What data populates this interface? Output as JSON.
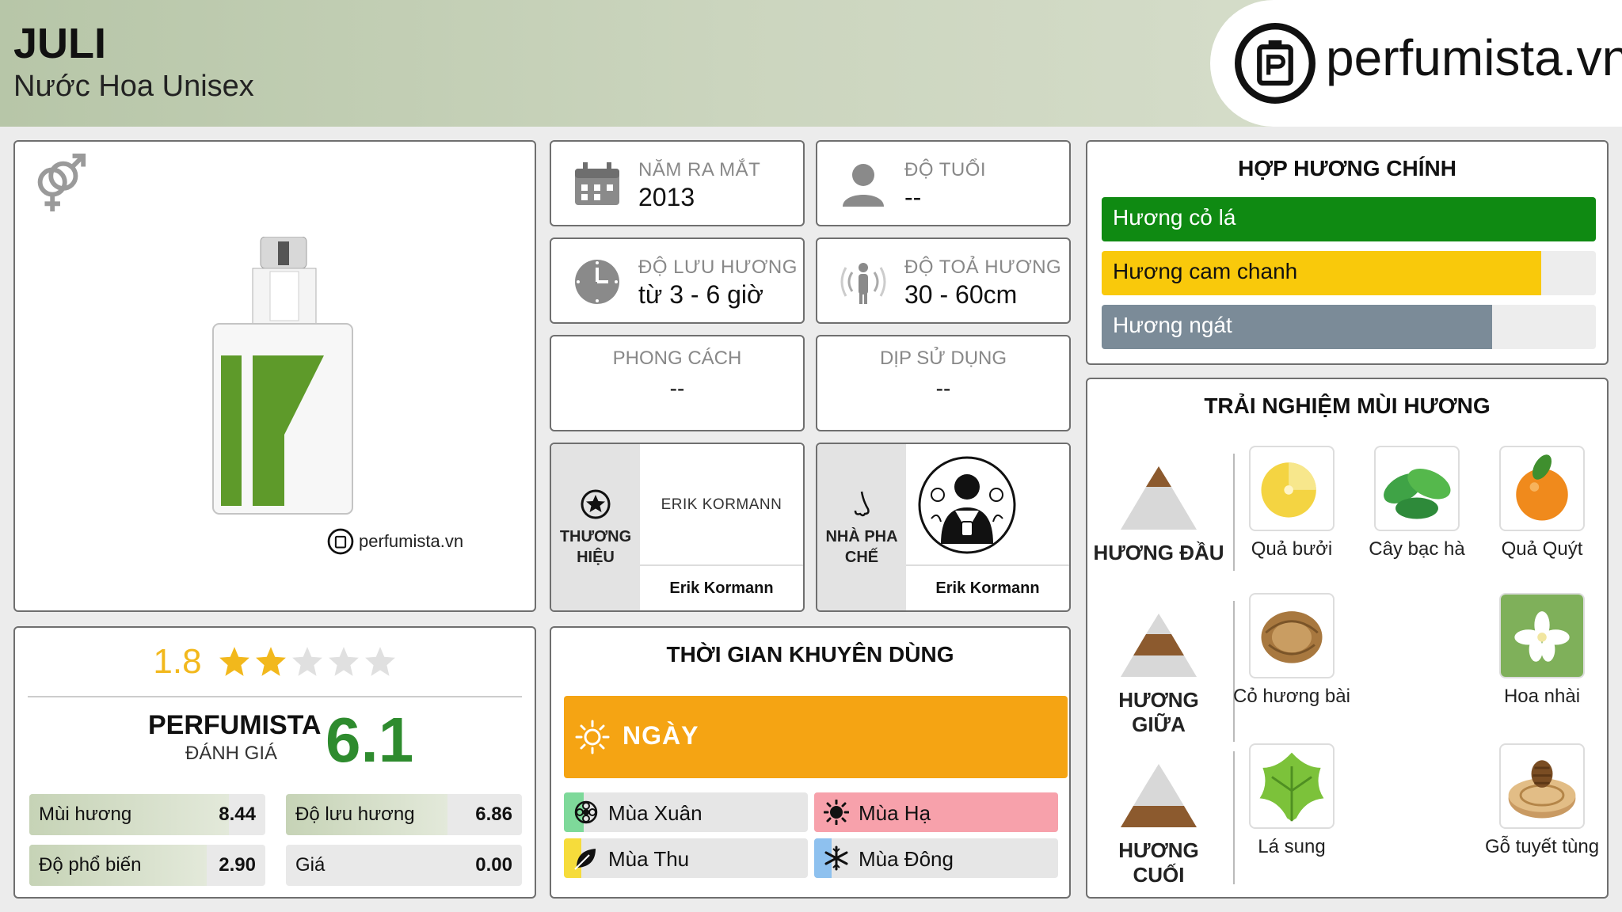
{
  "header": {
    "product_name": "JULI",
    "subtitle": "Nước Hoa Unisex",
    "logo_text": "perfumista.vn"
  },
  "image_card": {
    "gender_icon": "unisex-icon",
    "watermark": "perfumista.vn"
  },
  "info": {
    "year": {
      "label": "NĂM RA MẮT",
      "value": "2013",
      "icon": "calendar-icon"
    },
    "age": {
      "label": "ĐỘ TUỔI",
      "value": "--",
      "icon": "person-icon"
    },
    "longevity": {
      "label": "ĐỘ LƯU HƯƠNG",
      "value": "từ 3 - 6 giờ",
      "icon": "clock-icon"
    },
    "sillage": {
      "label": "ĐỘ TOẢ HƯƠNG",
      "value": "30 - 60cm",
      "icon": "sillage-icon"
    },
    "style": {
      "label": "PHONG CÁCH",
      "value": "--"
    },
    "occasion": {
      "label": "DỊP SỬ DỤNG",
      "value": "--"
    }
  },
  "brand": {
    "label": "THƯƠNG HIỆU",
    "logo_text": "ERIK KORMANN",
    "name": "Erik Kormann",
    "icon": "star-badge-icon"
  },
  "perfumer": {
    "label": "NHÀ PHA CHẾ",
    "name": "Erik Kormann",
    "icon": "nose-icon"
  },
  "accords": {
    "title": "HỢP HƯƠNG CHÍNH",
    "items": [
      {
        "label": "Hương cỏ lá",
        "value": 1.0,
        "color": "#0f8a12",
        "text_color": "#ffffff"
      },
      {
        "label": "Hương cam chanh",
        "value": 0.89,
        "color": "#f9c90b",
        "text_color": "#111111"
      },
      {
        "label": "Hương ngát",
        "value": 0.79,
        "color": "#7b8b98",
        "text_color": "#ffffff"
      }
    ]
  },
  "experience": {
    "title": "TRẢI NGHIỆM MÙI HƯƠNG",
    "stages": [
      {
        "label": "HƯƠNG ĐẦU",
        "notes": [
          "Quả bưởi",
          "Cây bạc hà",
          "Quả Quýt"
        ]
      },
      {
        "label": "HƯƠNG GIỮA",
        "notes": [
          "Cỏ hương bài",
          "Hoa nhài"
        ]
      },
      {
        "label": "HƯƠNG CUỐI",
        "notes": [
          "Lá sung",
          "Gỗ tuyết tùng"
        ]
      }
    ]
  },
  "rating": {
    "score": "1.8",
    "stars_filled": 2,
    "stars_total": 5,
    "pf_label_1": "PERFUMISTA",
    "pf_label_2": "ĐÁNH GIÁ",
    "pf_score": "6.1",
    "metrics": [
      {
        "label": "Mùi hương",
        "value": "8.44",
        "ratio": 0.844
      },
      {
        "label": "Độ lưu hương",
        "value": "6.86",
        "ratio": 0.686
      },
      {
        "label": "Độ phổ biến",
        "value": "2.90",
        "ratio": 0.75
      },
      {
        "label": "Giá",
        "value": "0.00",
        "ratio": 0.0
      }
    ]
  },
  "time": {
    "title": "THỜI GIAN KHUYÊN DÙNG",
    "day_label": "NGÀY",
    "seasons": [
      {
        "label": "Mùa Xuân",
        "color": "#7ed99a",
        "fill": 0.08,
        "icon": "spring-icon"
      },
      {
        "label": "Mùa Hạ",
        "color": "#f7a1ab",
        "fill": 1.0,
        "icon": "summer-icon"
      },
      {
        "label": "Mùa Thu",
        "color": "#f6dc3b",
        "fill": 0.07,
        "icon": "autumn-icon"
      },
      {
        "label": "Mùa Đông",
        "color": "#8ec1ef",
        "fill": 0.07,
        "icon": "winter-icon"
      }
    ]
  }
}
